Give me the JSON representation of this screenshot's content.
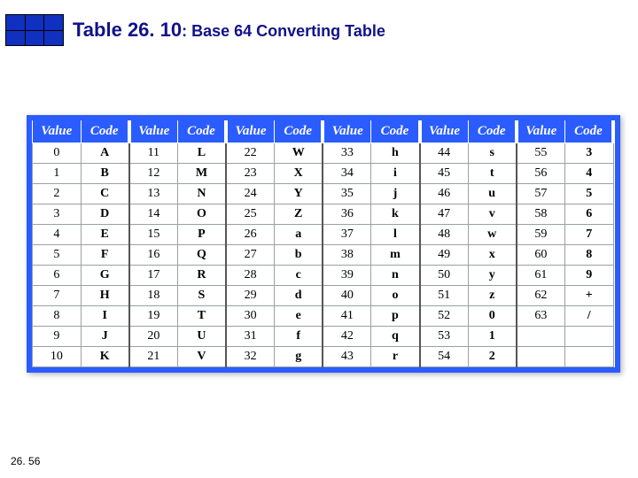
{
  "header": {
    "title_main": "Table 26. 10",
    "title_sub": ": Base 64 Converting Table"
  },
  "page_number": "26. 56",
  "columns": [
    "Value",
    "Code",
    "Value",
    "Code",
    "Value",
    "Code",
    "Value",
    "Code",
    "Value",
    "Code",
    "Value",
    "Code"
  ],
  "chart_data": {
    "type": "table",
    "title": "Table 26.10: Base64 Converting Table",
    "columns": [
      "Value",
      "Code"
    ],
    "rows": [
      {
        "value": 0,
        "code": "A"
      },
      {
        "value": 1,
        "code": "B"
      },
      {
        "value": 2,
        "code": "C"
      },
      {
        "value": 3,
        "code": "D"
      },
      {
        "value": 4,
        "code": "E"
      },
      {
        "value": 5,
        "code": "F"
      },
      {
        "value": 6,
        "code": "G"
      },
      {
        "value": 7,
        "code": "H"
      },
      {
        "value": 8,
        "code": "I"
      },
      {
        "value": 9,
        "code": "J"
      },
      {
        "value": 10,
        "code": "K"
      },
      {
        "value": 11,
        "code": "L"
      },
      {
        "value": 12,
        "code": "M"
      },
      {
        "value": 13,
        "code": "N"
      },
      {
        "value": 14,
        "code": "O"
      },
      {
        "value": 15,
        "code": "P"
      },
      {
        "value": 16,
        "code": "Q"
      },
      {
        "value": 17,
        "code": "R"
      },
      {
        "value": 18,
        "code": "S"
      },
      {
        "value": 19,
        "code": "T"
      },
      {
        "value": 20,
        "code": "U"
      },
      {
        "value": 21,
        "code": "V"
      },
      {
        "value": 22,
        "code": "W"
      },
      {
        "value": 23,
        "code": "X"
      },
      {
        "value": 24,
        "code": "Y"
      },
      {
        "value": 25,
        "code": "Z"
      },
      {
        "value": 26,
        "code": "a"
      },
      {
        "value": 27,
        "code": "b"
      },
      {
        "value": 28,
        "code": "c"
      },
      {
        "value": 29,
        "code": "d"
      },
      {
        "value": 30,
        "code": "e"
      },
      {
        "value": 31,
        "code": "f"
      },
      {
        "value": 32,
        "code": "g"
      },
      {
        "value": 33,
        "code": "h"
      },
      {
        "value": 34,
        "code": "i"
      },
      {
        "value": 35,
        "code": "j"
      },
      {
        "value": 36,
        "code": "k"
      },
      {
        "value": 37,
        "code": "l"
      },
      {
        "value": 38,
        "code": "m"
      },
      {
        "value": 39,
        "code": "n"
      },
      {
        "value": 40,
        "code": "o"
      },
      {
        "value": 41,
        "code": "p"
      },
      {
        "value": 42,
        "code": "q"
      },
      {
        "value": 43,
        "code": "r"
      },
      {
        "value": 44,
        "code": "s"
      },
      {
        "value": 45,
        "code": "t"
      },
      {
        "value": 46,
        "code": "u"
      },
      {
        "value": 47,
        "code": "v"
      },
      {
        "value": 48,
        "code": "w"
      },
      {
        "value": 49,
        "code": "x"
      },
      {
        "value": 50,
        "code": "y"
      },
      {
        "value": 51,
        "code": "z"
      },
      {
        "value": 52,
        "code": "0"
      },
      {
        "value": 53,
        "code": "1"
      },
      {
        "value": 54,
        "code": "2"
      },
      {
        "value": 55,
        "code": "3"
      },
      {
        "value": 56,
        "code": "4"
      },
      {
        "value": 57,
        "code": "5"
      },
      {
        "value": 58,
        "code": "6"
      },
      {
        "value": 59,
        "code": "7"
      },
      {
        "value": 60,
        "code": "8"
      },
      {
        "value": 61,
        "code": "9"
      },
      {
        "value": 62,
        "code": "+"
      },
      {
        "value": 63,
        "code": "/"
      }
    ]
  }
}
